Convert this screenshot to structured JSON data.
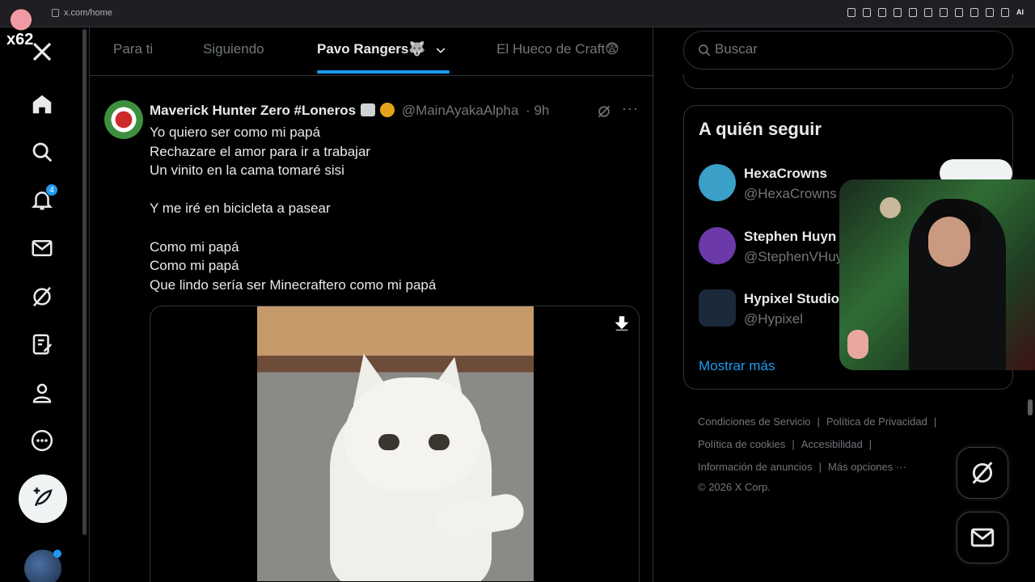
{
  "browser": {
    "url": "x.com/home",
    "extensions_label": "AI"
  },
  "overlay_tag": "x62",
  "nav": {
    "items": [
      {
        "name": "home",
        "icon": "home-icon"
      },
      {
        "name": "explore",
        "icon": "search-icon"
      },
      {
        "name": "notifications",
        "icon": "bell-icon",
        "badge": "4"
      },
      {
        "name": "messages",
        "icon": "mail-icon"
      },
      {
        "name": "grok",
        "icon": "grok-icon"
      },
      {
        "name": "lists",
        "icon": "lists-icon"
      },
      {
        "name": "profile",
        "icon": "person-icon"
      },
      {
        "name": "more",
        "icon": "more-circle-icon"
      }
    ],
    "post_icon": "feather-plus-icon"
  },
  "tabs": [
    {
      "label": "Para ti",
      "active": false
    },
    {
      "label": "Siguiendo",
      "active": false
    },
    {
      "label": "Pavo Rangers🐺",
      "active": true
    },
    {
      "label": "El Hueco de Craft😨",
      "active": false
    }
  ],
  "tweet": {
    "name": "Maverick Hunter Zero #Loneros",
    "handle": "@MainAyakaAlpha",
    "time": "· 9h",
    "more": "···",
    "lines": [
      "Yo quiero ser como mi papá",
      "Rechazare el amor para ir a trabajar",
      "Un vinito en la cama tomaré sisi",
      "",
      "Y me iré en bicicleta a pasear",
      "",
      "Como mi papá",
      "Como mi papá",
      "Que lindo sería ser Minecraftero como mi papá"
    ]
  },
  "search": {
    "placeholder": "Buscar"
  },
  "who_to_follow": {
    "title": "A quién seguir",
    "users": [
      {
        "name": "HexaCrowns",
        "handle": "@HexaCrowns",
        "avatar_color": "#3aa0c8"
      },
      {
        "name": "Stephen Huyn",
        "handle": "@StephenVHuy",
        "avatar_color": "#6b3aa8"
      },
      {
        "name": "Hypixel Studio",
        "handle": "@Hypixel",
        "avatar_color": "#1b2a3a"
      }
    ],
    "show_more": "Mostrar más"
  },
  "footer": {
    "links": [
      "Condiciones de Servicio",
      "Política de Privacidad",
      "Política de cookies",
      "Accesibilidad",
      "Información de anuncios",
      "Más opciones ···"
    ],
    "copyright": "© 2026 X Corp."
  },
  "colors": {
    "accent": "#1d9bf0",
    "background": "#000000",
    "muted_text": "#71767b",
    "border": "#2f3336"
  }
}
